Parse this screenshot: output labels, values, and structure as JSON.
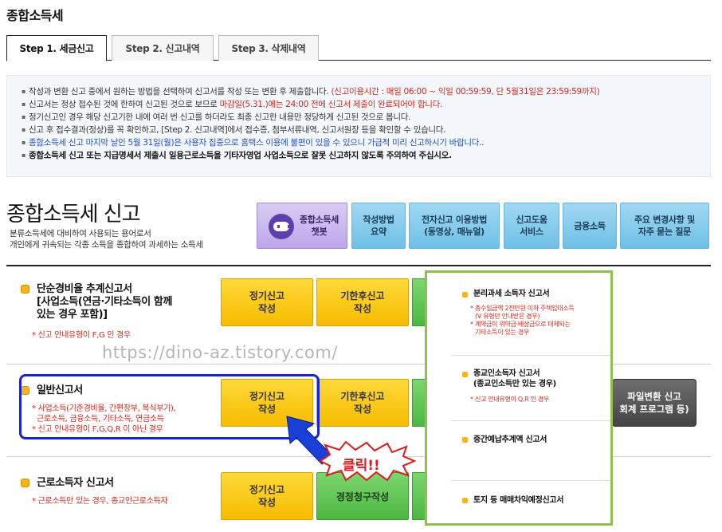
{
  "page_title": "종합소득세",
  "tabs": [
    {
      "label": "Step 1. 세금신고",
      "active": true
    },
    {
      "label": "Step 2. 신고내역",
      "active": false
    },
    {
      "label": "Step 3. 삭제내역",
      "active": false
    }
  ],
  "notice": {
    "line1_a": "작성과 변환 신고 중에서 원하는 방법을 선택하여 신고서를 작성 또는 변환 후 제출합니다.",
    "line1_b": " (신고이용시간 : 매일 06:00 ~ 익일 00:59:59, 단 5월31일은 23:59:59까지)",
    "line2_a": "신고서는 정상 접수된 것에 한하여 신고된 것으로 보므로 ",
    "line2_b": "마감일(5.31.)에는 24:00 전에 신고서 제출이 완료되어야 합니다.",
    "line3": "정기신고인 경우 해당 신고기한 내에 여러 번 신고를 하더라도 최종 신고한 내용만 정당하게 신고된 것으로 봅니다.",
    "line4": "신고 후 접수결과(정상)를 꼭 확인하고, [Step 2. 신고내역]에서 접수증, 첨부서류내역, 신고서원장 등을 확인할 수 있습니다.",
    "line5": "종합소득세 신고 마지막 날인 5월 31일(월)은 사용자 집중으로 홈택스 이용에 불편이 있을 수 있으니 가급적 미리 신고하시기 바랍니다..",
    "line6": "종합소득세 신고 또는 지급명세서 제출시 일용근로소득을 기타자영업 사업소득으로 잘못 신고하지 않도록 주의하여 주십시오."
  },
  "heading": {
    "title": "종합소득세 신고",
    "desc1": "분류소득세에 대비하여 사용되는 용어로서",
    "desc2": "개인에게 귀속되는 각종 소득을 종합하여 과세하는 소득세"
  },
  "top_buttons": {
    "chatbot": "종합소득세\n챗봇",
    "guide": "작성방법\n요약",
    "elec": "전자신고 이용방법\n(동영상, 매뉴얼)",
    "help": "신고도움\n서비스",
    "finance": "금융소득",
    "faq": "주요 변경사항 및\n자주 묻는 질문"
  },
  "sections": {
    "simple": {
      "title": "단순경비율 추계신고서\n[사업소득(연금·기타소득이 함께\n있는 경우 포함)]",
      "note": "* 신고 안내유형이 F,G 인 경우",
      "btn_regular": "정기신고\n작성",
      "btn_late": "기한후신고\n작성"
    },
    "general": {
      "title": "일반신고서",
      "note1": "* 사업소득(기준경비율, 간편장부, 복식부기),",
      "note2": "근로소득, 금융소득, 기타소득, 연금소득",
      "note3": "* 신고 안내유형이 F,G,Q,R 이 아닌 경우",
      "btn_regular": "정기신고\n작성",
      "btn_late": "기한후신고\n작성",
      "btn_file": "파일변환 신고\n회계 프로그램 등)"
    },
    "earned": {
      "title": "근로소득자 신고서",
      "note": "* 근로소득만 있는 경우, 종교인근로소득자",
      "btn_regular": "정기신고\n작성",
      "btn_correction": "경정청구작성"
    }
  },
  "watermark": "https://dino-az.tistory.com/",
  "click_label": "클릭!!",
  "popup": {
    "item1": "분리과세 소득자 신고서",
    "item1_note1": "* 총수입금액 2천만원 이하 주택임대소득",
    "item1_note2": "(V 유형만 안내받은 경우)",
    "item1_note3": "* 계약금이 위약금·배상금으로 대체되는",
    "item1_note4": "기타소득이 있는 경우",
    "item2_a": "종교인소득자 신고서",
    "item2_b": "(종교인소득만 있는 경우)",
    "item2_note": "* 신고 안내유형이 Q,R 인 경우",
    "item3": "중간예납추계액 신고서",
    "item4": "토지 등 매매차익예정신고서"
  },
  "colors": {
    "yellow_button": "#f6bc00",
    "green_button": "#4cb840",
    "highlight_blue": "#1723d9",
    "popup_border": "#8dc24a",
    "notice_red": "#d8261b"
  }
}
